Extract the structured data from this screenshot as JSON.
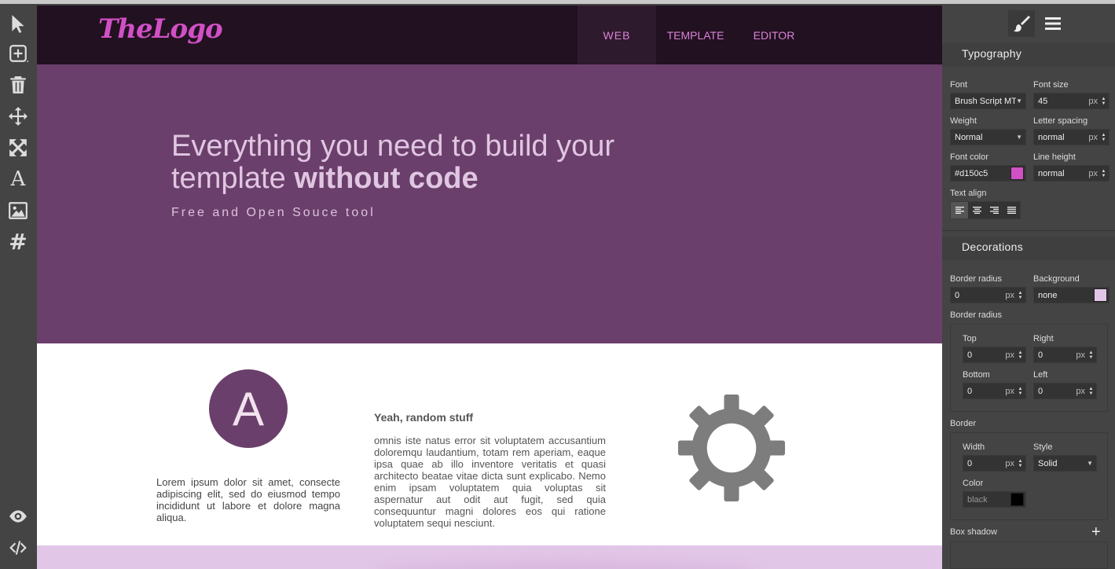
{
  "toolbar": {
    "tools": [
      {
        "icon": "select-arrow-icon"
      },
      {
        "icon": "add-block-icon"
      },
      {
        "icon": "trash-icon"
      },
      {
        "icon": "move-icon"
      },
      {
        "icon": "resize-icon"
      },
      {
        "icon": "text-icon",
        "glyph": "A"
      },
      {
        "icon": "image-icon"
      },
      {
        "icon": "hash-icon",
        "glyph": "#"
      }
    ],
    "bottom_tools": [
      {
        "icon": "eye-icon"
      },
      {
        "icon": "code-icon"
      }
    ]
  },
  "canvas": {
    "logo": "TheLogo",
    "nav": [
      "WEB",
      "TEMPLATE",
      "EDITOR"
    ],
    "hero": {
      "title_light": "Everything you need to build your template",
      "title_bold": "without code",
      "subtitle": "Free and Open Souce tool"
    },
    "features": {
      "circle_letter": "A",
      "col1_text": "Lorem ipsum dolor sit amet, consecte adipiscing elit, sed do eiusmod tempo incididunt ut labore et dolore magna aliqua.",
      "col2_title": "Yeah, random stuff",
      "col2_text": "omnis iste natus error sit voluptatem accusantium doloremqu laudantium, totam rem aperiam, eaque ipsa quae ab illo inventore veritatis et quasi architecto beatae vitae dicta sunt explicabo. Nemo enim ipsam voluptatem quia voluptas sit aspernatur aut odit aut fugit, sed quia consequuntur magni dolores eos qui ratione voluptatem sequi nesciunt."
    },
    "colors": {
      "nav_bg": "#221121",
      "hero_bg": "#6b3f6b",
      "logo": "#d150c5",
      "strip": "#e2c6e7"
    }
  },
  "panel": {
    "typography": {
      "header": "Typography",
      "font_label": "Font",
      "font_value": "Brush Script MT",
      "size_label": "Font size",
      "size_value": "45",
      "size_unit": "px",
      "weight_label": "Weight",
      "weight_value": "Normal",
      "spacing_label": "Letter spacing",
      "spacing_value": "normal",
      "spacing_unit": "px",
      "color_label": "Font color",
      "color_value": "#d150c5",
      "color_swatch": "#d150c5",
      "lineheight_label": "Line height",
      "lineheight_value": "normal",
      "lineheight_unit": "px",
      "align_label": "Text align"
    },
    "decorations": {
      "header": "Decorations",
      "radius_label": "Border radius",
      "radius_value": "0",
      "radius_unit": "px",
      "bg_label": "Background",
      "bg_value": "none",
      "bg_swatch": "#e2c6e7",
      "radius_group_label": "Border radius",
      "top_label": "Top",
      "top_value": "0",
      "right_label": "Right",
      "right_value": "0",
      "bottom_label": "Bottom",
      "bottom_value": "0",
      "left_label": "Left",
      "left_value": "0",
      "corner_unit": "px",
      "border_label": "Border",
      "width_label": "Width",
      "width_value": "0",
      "width_unit": "px",
      "style_label": "Style",
      "style_value": "Solid",
      "bcolor_label": "Color",
      "bcolor_value": "black",
      "bcolor_swatch": "#000000",
      "shadow_label": "Box shadow",
      "shadow_add": "+"
    }
  }
}
